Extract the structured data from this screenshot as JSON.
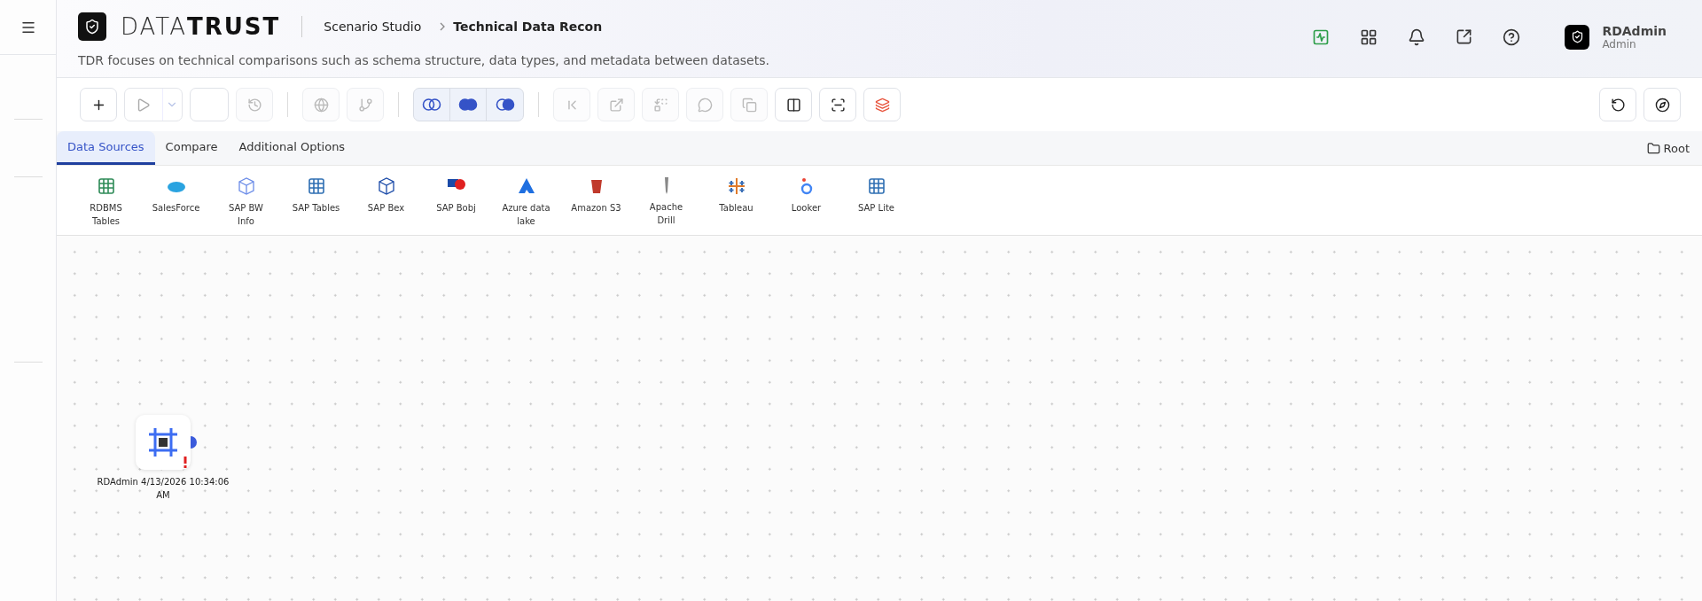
{
  "brand": {
    "logo": "DATA**TRUST**"
  },
  "breadcrumb": [
    {
      "label": "Scenario Studio",
      "current": false
    },
    {
      "label": "Technical Data Recon",
      "current": true
    }
  ],
  "subtitle": "TDR focuses on technical comparisons such as schema structure, data types, and metadata between datasets.",
  "user": {
    "name": "RDAdmin",
    "role": "Admin"
  },
  "toolbar": [
    {
      "kind": "button",
      "disabled": false
    },
    {
      "kind": "split",
      "disabled": true
    },
    {
      "kind": "blank"
    },
    {
      "kind": "button",
      "disabled": true
    },
    {
      "kind": "sep"
    },
    {
      "kind": "button",
      "disabled": true
    },
    {
      "kind": "button",
      "disabled": true
    },
    {
      "kind": "sep"
    },
    {
      "kind": "join"
    },
    {
      "kind": "sep"
    },
    {
      "kind": "button",
      "disabled": true
    },
    {
      "kind": "button",
      "disabled": true
    },
    {
      "kind": "button",
      "disabled": true
    },
    {
      "kind": "button",
      "disabled": true
    },
    {
      "kind": "button",
      "disabled": true
    },
    {
      "kind": "button",
      "disabled": false
    },
    {
      "kind": "button",
      "disabled": false
    },
    {
      "kind": "button",
      "disabled": false
    }
  ],
  "tabs": [
    {
      "label": "Data Sources",
      "selected": true
    },
    {
      "label": "Compare",
      "selected": false
    },
    {
      "label": "Additional Options",
      "selected": false
    }
  ],
  "root": "Root",
  "sources": [
    "RDBMS Tables",
    "SalesForce",
    "SAP BW Info",
    "SAP Tables",
    "SAP Bex",
    "SAP Bobj",
    "Azure data lake",
    "Amazon S3",
    "Apache Drill",
    "Tableau",
    "Looker",
    "SAP Lite"
  ],
  "node": {
    "label": "RDAdmin 4/13/2026 10:34:06 AM",
    "warning": true
  }
}
